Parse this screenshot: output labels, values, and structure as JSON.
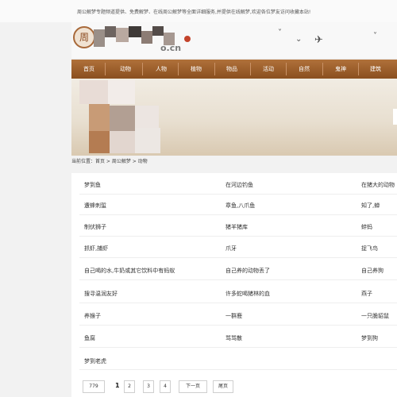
{
  "topbar": {
    "text": "周公解梦专题频道提供、免费解梦、在线周公解梦等全面详细服务,并提供在线解梦,欢迎各位梦友访问收藏本站!"
  },
  "logo": {
    "mark": "周",
    "domain": "o.cn"
  },
  "nav": {
    "items": [
      "首页",
      "动物",
      "人物",
      "植物",
      "物品",
      "活动",
      "自然",
      "鬼神",
      "建筑"
    ]
  },
  "breadcrumb": "当前位置：首页 > 周公解梦 > 动物",
  "list": {
    "col1": [
      "梦到鱼",
      "遭蜂刺蜇",
      "制伏狮子",
      "抓虾,捕虾",
      "自己喝的水,牛奶或其它饮料中有蚂蚁",
      "搜寻温润友好",
      "养猴子",
      "鱼腐",
      "梦到老虎"
    ],
    "col2": [
      "在河边钓鱼",
      "章鱼,八爪鱼",
      "猪羊猪库",
      "爪牙",
      "自己养的动物丢了",
      "许多蛇喝猪林的血",
      "一群鹿",
      "骂骂散"
    ],
    "col3": [
      "在猪大的动物",
      "知了,蝉",
      "蚌蚂",
      "捉飞鸟",
      "自己养狗",
      "燕子",
      "一只脆貂鼠",
      "梦到狗"
    ]
  },
  "pagination": {
    "total": "779",
    "current": "1",
    "pages": [
      "2",
      "3",
      "4"
    ],
    "next": "下一页",
    "last": "尾页"
  }
}
